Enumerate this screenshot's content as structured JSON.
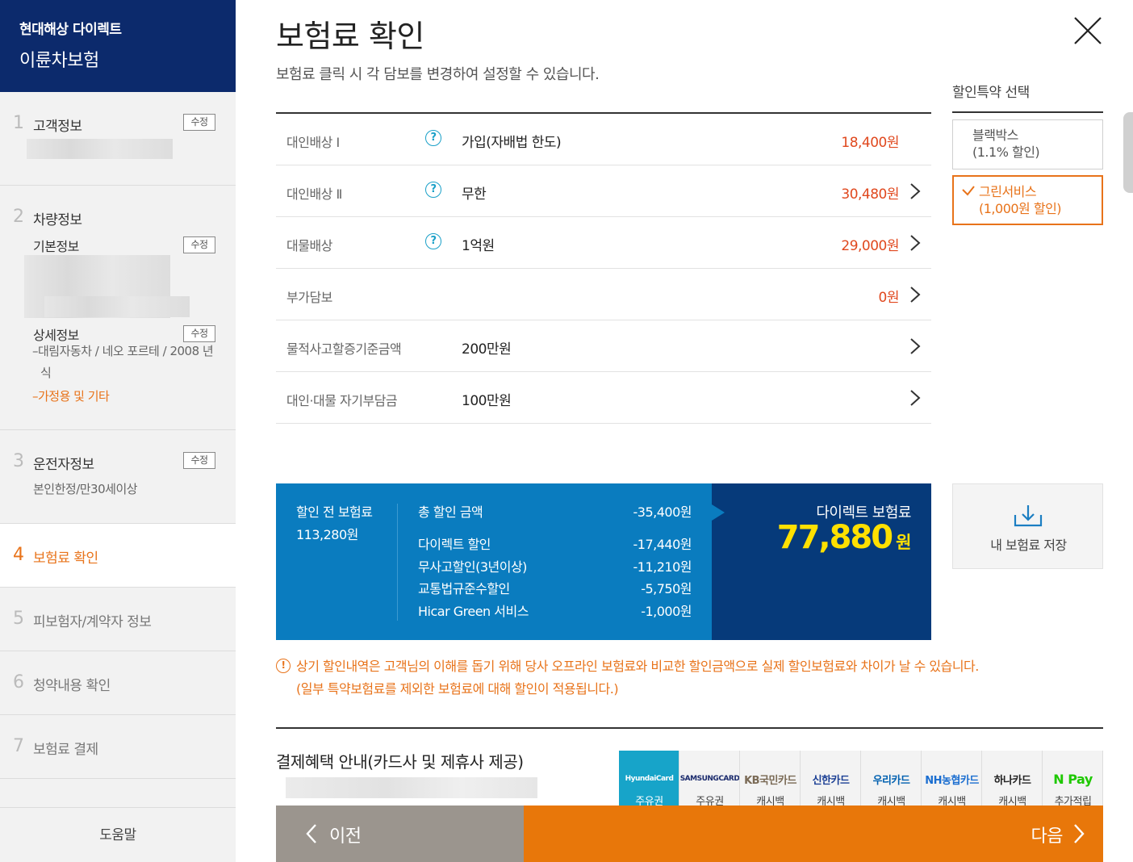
{
  "brand": {
    "company": "현대해상 다이렉트",
    "product": "이륜차보험"
  },
  "steps": [
    {
      "num": "1",
      "title": "고객정보",
      "edit": "수정"
    },
    {
      "num": "2",
      "title": "차량정보",
      "basic_label": "기본정보",
      "basic_edit": "수정",
      "detail_label": "상세정보",
      "detail_edit": "수정",
      "detail_line1": "대림자동차 / 네오 포르테 / 2008 년식",
      "detail_line2": "가정용 및 기타"
    },
    {
      "num": "3",
      "title": "운전자정보",
      "edit": "수정",
      "detail": "본인한정/만30세이상"
    },
    {
      "num": "4",
      "title": "보험료 확인"
    },
    {
      "num": "5",
      "title": "피보험자/계약자 정보"
    },
    {
      "num": "6",
      "title": "청약내용 확인"
    },
    {
      "num": "7",
      "title": "보험료 결제"
    }
  ],
  "help_label": "도움말",
  "page": {
    "title": "보험료 확인",
    "subtitle": "보험료 클릭 시 각 담보를 변경하여 설정할 수 있습니다."
  },
  "coverages": [
    {
      "name": "대인배상 Ⅰ",
      "help": "?",
      "value": "가입(자배법 한도)",
      "price": "18,400원",
      "arrow": false
    },
    {
      "name": "대인배상 Ⅱ",
      "help": "?",
      "value": "무한",
      "price": "30,480원",
      "arrow": true
    },
    {
      "name": "대물배상",
      "help": "?",
      "value": "1억원",
      "price": "29,000원",
      "arrow": true
    },
    {
      "name": "부가담보",
      "help": "",
      "value": "",
      "price": "0원",
      "arrow": true
    },
    {
      "name": "물적사고할증기준금액",
      "help": "",
      "value": "200만원",
      "price": "",
      "arrow": true
    },
    {
      "name": "대인·대물 자기부담금",
      "help": "",
      "value": "100만원",
      "price": "",
      "arrow": true
    }
  ],
  "discount_options": {
    "title": "할인특약 선택",
    "items": [
      {
        "line1": "블랙박스",
        "line2": "(1.1% 할인)",
        "selected": false
      },
      {
        "line1": "그린서비스",
        "line2": "(1,000원 할인)",
        "selected": true
      }
    ]
  },
  "summary": {
    "before_label": "할인 전 보험료",
    "before_amount": "113,280원",
    "total_label": "총 할인 금액",
    "total_amount": "-35,400원",
    "items": [
      {
        "label": "다이렉트 할인",
        "amount": "-17,440원"
      },
      {
        "label": "무사고할인(3년이상)",
        "amount": "-11,210원"
      },
      {
        "label": "교통법규준수할인",
        "amount": "-5,750원"
      },
      {
        "label": "Hicar Green 서비스",
        "amount": "-1,000원"
      }
    ],
    "direct_label": "다이렉트 보험료",
    "direct_amount": "77,880",
    "direct_unit": "원"
  },
  "save_label": "내 보험료 저장",
  "notice": {
    "icon": "!",
    "line1": "상기 할인내역은 고객님의 이해를 돕기 위해 당사 오프라인 보험료와 비교한 할인금액으로 실제 할인보험료와 차이가 날 수 있습니다.",
    "line2": "(일부 특약보험료를 제외한 보험료에 대해 할인이 적용됩니다.)"
  },
  "payment": {
    "title": "결제혜택 안내(카드사 및 제휴사 제공)",
    "cards": [
      {
        "logo": "HyundaiCard",
        "label": "주유권",
        "color": "#ffffff"
      },
      {
        "logo": "SAMSUNGCARD",
        "label": "주유권",
        "color": "#1a2a6c"
      },
      {
        "logo": "KB국민카드",
        "label": "캐시백",
        "color": "#7a6a55"
      },
      {
        "logo": "신한카드",
        "label": "캐시백",
        "color": "#1b3f94"
      },
      {
        "logo": "우리카드",
        "label": "캐시백",
        "color": "#0060b0"
      },
      {
        "logo": "NH농협카드",
        "label": "캐시백",
        "color": "#1b6ed0"
      },
      {
        "logo": "하나카드",
        "label": "캐시백",
        "color": "#222222"
      },
      {
        "logo": "N Pay",
        "label": "추가적립",
        "color": "#1ec800"
      }
    ]
  },
  "nav": {
    "prev": "이전",
    "next": "다음"
  },
  "colors": {
    "navy": "#0c2a6c",
    "accent": "#e8731a",
    "blue": "#0a7cbf",
    "dark_blue": "#063a7a",
    "yellow": "#ffe000"
  }
}
